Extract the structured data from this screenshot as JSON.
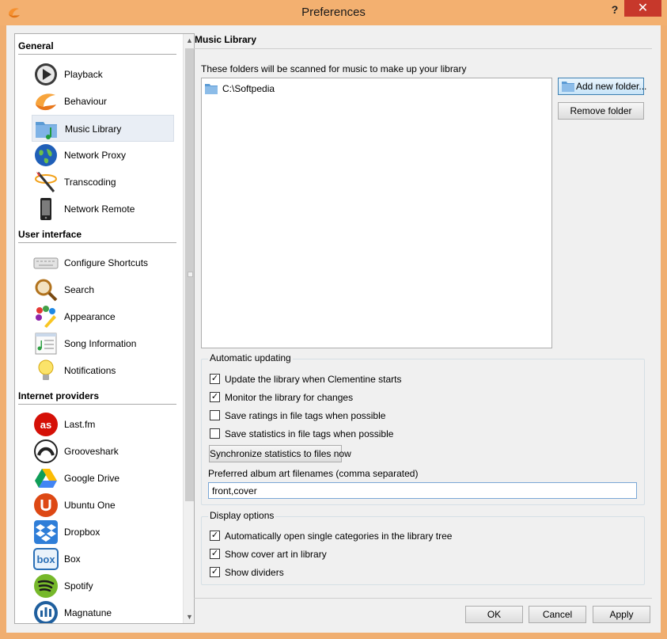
{
  "window": {
    "title": "Preferences",
    "help_glyph": "?",
    "close_glyph": "✕"
  },
  "sidebar": {
    "groups": [
      {
        "label": "General"
      },
      {
        "label": "User interface"
      },
      {
        "label": "Internet providers"
      }
    ],
    "items": [
      {
        "label": "Playback",
        "icon": "playback-icon"
      },
      {
        "label": "Behaviour",
        "icon": "clementine-icon"
      },
      {
        "label": "Music Library",
        "icon": "music-folder-icon",
        "selected": true
      },
      {
        "label": "Network Proxy",
        "icon": "globe-icon"
      },
      {
        "label": "Transcoding",
        "icon": "transcoding-icon"
      },
      {
        "label": "Network Remote",
        "icon": "phone-icon"
      },
      {
        "label": "Configure Shortcuts",
        "icon": "keyboard-icon"
      },
      {
        "label": "Search",
        "icon": "magnifier-icon"
      },
      {
        "label": "Appearance",
        "icon": "palette-icon"
      },
      {
        "label": "Song Information",
        "icon": "song-info-icon"
      },
      {
        "label": "Notifications",
        "icon": "lightbulb-icon"
      },
      {
        "label": "Last.fm",
        "icon": "lastfm-icon"
      },
      {
        "label": "Grooveshark",
        "icon": "grooveshark-icon"
      },
      {
        "label": "Google Drive",
        "icon": "google-drive-icon"
      },
      {
        "label": "Ubuntu One",
        "icon": "ubuntu-one-icon"
      },
      {
        "label": "Dropbox",
        "icon": "dropbox-icon"
      },
      {
        "label": "Box",
        "icon": "box-icon"
      },
      {
        "label": "Spotify",
        "icon": "spotify-icon"
      },
      {
        "label": "Magnatune",
        "icon": "magnatune-icon"
      }
    ]
  },
  "main": {
    "section_title": "Music Library",
    "folders_label": "These folders will be scanned for music to make up your library",
    "folders": [
      "C:\\Softpedia"
    ],
    "add_folder_label": "Add new folder...",
    "remove_folder_label": "Remove folder",
    "auto_update": {
      "title": "Automatic updating",
      "options": [
        {
          "label": "Update the library when Clementine starts",
          "checked": true
        },
        {
          "label": "Monitor the library for changes",
          "checked": true
        },
        {
          "label": "Save ratings in file tags when possible",
          "checked": false
        },
        {
          "label": "Save statistics in file tags when possible",
          "checked": false
        }
      ],
      "sync_label": "Synchronize statistics to files now",
      "album_art_label": "Preferred album art filenames (comma separated)",
      "album_art_value": "front,cover"
    },
    "display": {
      "title": "Display options",
      "options": [
        {
          "label": "Automatically open single categories in the library tree",
          "checked": true
        },
        {
          "label": "Show cover art in library",
          "checked": true
        },
        {
          "label": "Show dividers",
          "checked": true
        }
      ]
    }
  },
  "footer": {
    "ok_label": "OK",
    "cancel_label": "Cancel",
    "apply_label": "Apply"
  },
  "colors": {
    "titlebar": "#f3b070",
    "close": "#c7382b",
    "selection": "#e9eef5"
  }
}
